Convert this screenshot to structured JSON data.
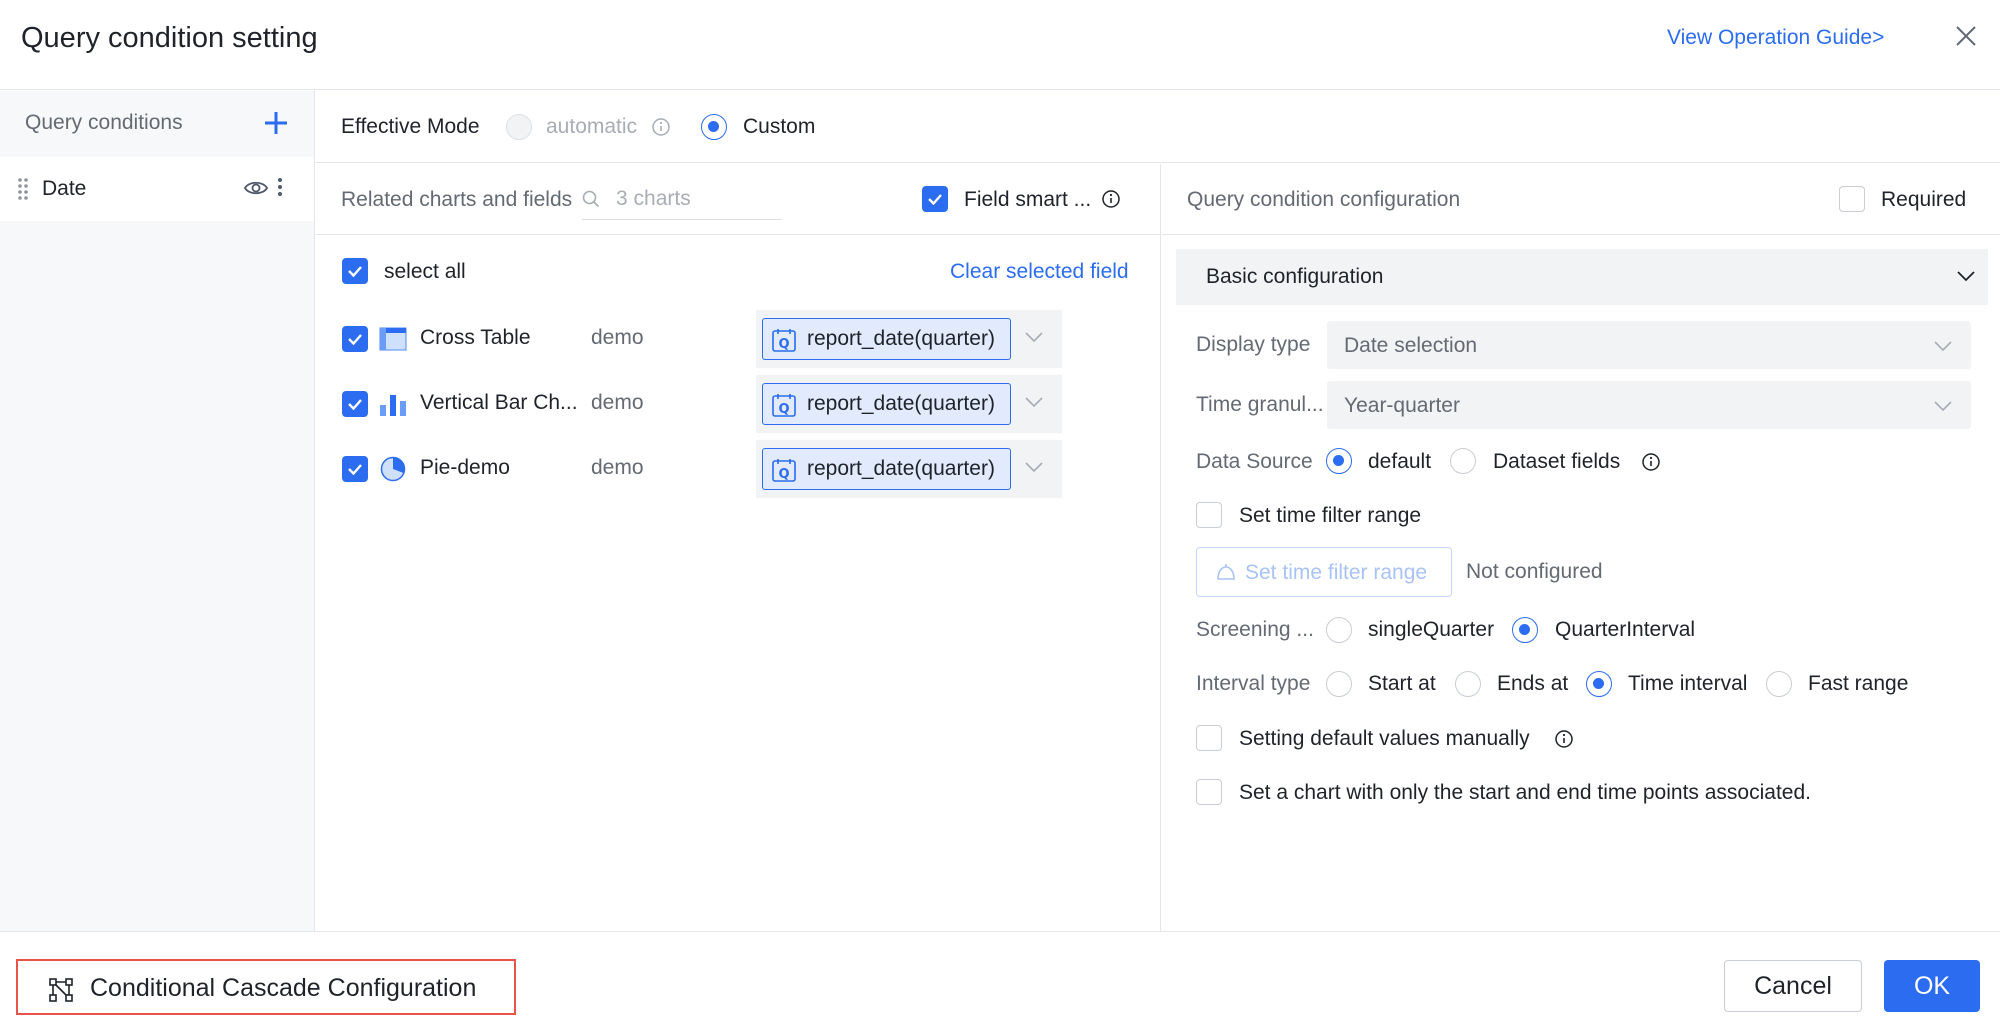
{
  "dialog": {
    "title": "Query condition setting",
    "guide_link": "View Operation Guide>"
  },
  "sidebar": {
    "heading": "Query conditions",
    "items": [
      {
        "label": "Date"
      }
    ]
  },
  "effective_mode": {
    "label": "Effective Mode",
    "options": [
      "automatic",
      "Custom"
    ],
    "selected": "Custom"
  },
  "related": {
    "label": "Related charts and fields",
    "search_placeholder": "3 charts",
    "smart_label": "Field smart ...",
    "smart_checked": true,
    "select_all_label": "select all",
    "clear_label": "Clear selected field",
    "charts": [
      {
        "name": "Cross Table",
        "dataset": "demo",
        "field": "report_date(quarter)",
        "icon": "cross-table-icon"
      },
      {
        "name": "Vertical Bar Ch...",
        "dataset": "demo",
        "field": "report_date(quarter)",
        "icon": "bar-chart-icon"
      },
      {
        "name": "Pie-demo",
        "dataset": "demo",
        "field": "report_date(quarter)",
        "icon": "pie-chart-icon"
      }
    ]
  },
  "config": {
    "heading": "Query condition configuration",
    "required_label": "Required",
    "section_title": "Basic configuration",
    "display_type": {
      "label": "Display type",
      "value": "Date selection"
    },
    "time_granularity": {
      "label": "Time granul...",
      "value": "Year-quarter"
    },
    "data_source": {
      "label": "Data Source",
      "options": [
        "default",
        "Dataset fields"
      ],
      "selected": "default"
    },
    "time_filter_checkbox": "Set time filter range",
    "time_filter_button": "Set time filter range",
    "time_filter_status": "Not configured",
    "screening": {
      "label": "Screening ...",
      "options": [
        "singleQuarter",
        "QuarterInterval"
      ],
      "selected": "QuarterInterval"
    },
    "interval_type": {
      "label": "Interval type",
      "options": [
        "Start at",
        "Ends at",
        "Time interval",
        "Fast range"
      ],
      "selected": "Time interval"
    },
    "default_values_label": "Setting default values manually",
    "start_end_label": "Set a chart with only the start and end time points associated."
  },
  "footer": {
    "cascade_label": "Conditional Cascade Configuration",
    "cancel_label": "Cancel",
    "ok_label": "OK"
  },
  "colors": {
    "accent": "#2b6cf0",
    "highlight_border": "#e8534a"
  }
}
